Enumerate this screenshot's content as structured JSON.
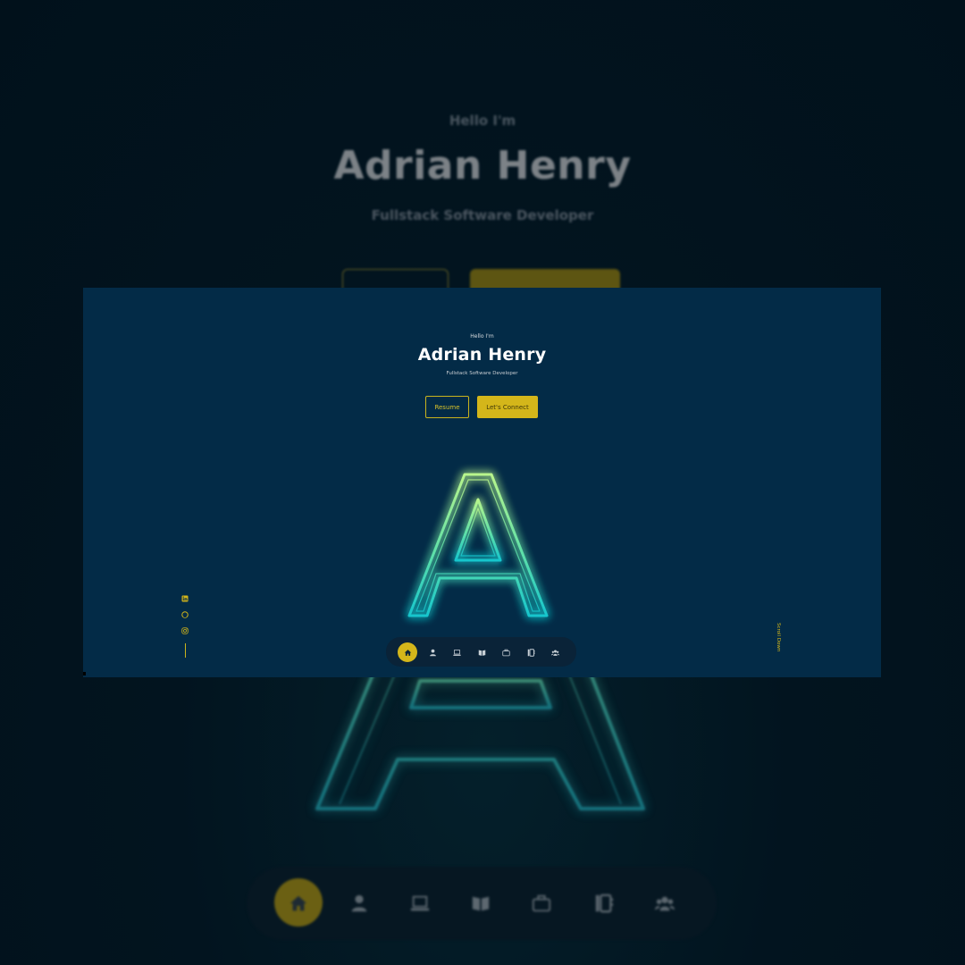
{
  "hero": {
    "greeting": "Hello I'm",
    "name": "Adrian Henry",
    "role": "Fullstack Software Developer",
    "resume_label": "Resume",
    "connect_label": "Let's Connect",
    "monogram": "A"
  },
  "socials": [
    {
      "name": "linkedin-icon"
    },
    {
      "name": "github-icon"
    },
    {
      "name": "instagram-icon"
    }
  ],
  "scroll_label": "Scroll Down",
  "nav": {
    "items": [
      {
        "icon": "home-icon",
        "active": true
      },
      {
        "icon": "user-icon",
        "active": false
      },
      {
        "icon": "laptop-code-icon",
        "active": false
      },
      {
        "icon": "book-open-icon",
        "active": false
      },
      {
        "icon": "briefcase-icon",
        "active": false
      },
      {
        "icon": "address-book-icon",
        "active": false
      },
      {
        "icon": "users-icon",
        "active": false
      }
    ]
  },
  "colors": {
    "background": "#01111b",
    "card": "#032b47",
    "accent": "#d4b61a",
    "neon_top": "#a8f08a",
    "neon_bottom": "#19c7c7"
  }
}
